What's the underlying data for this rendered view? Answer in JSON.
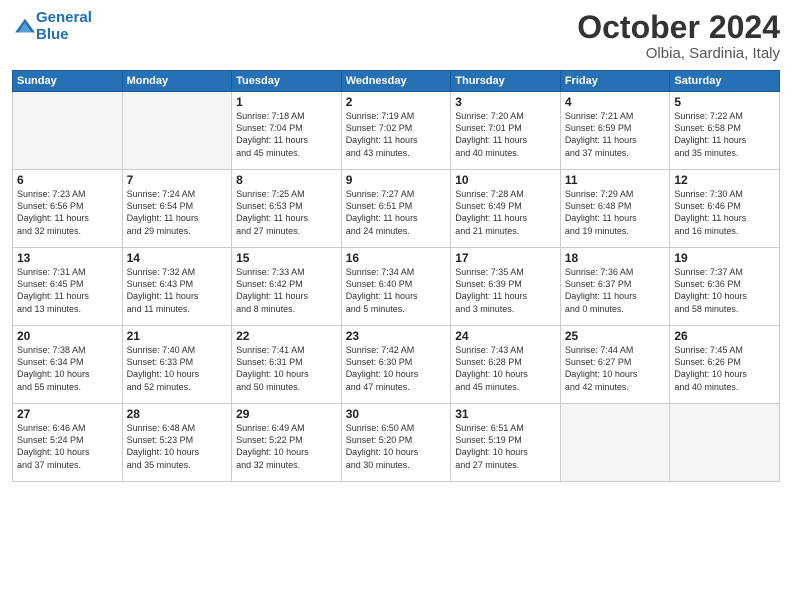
{
  "header": {
    "logo_general": "General",
    "logo_blue": "Blue",
    "month": "October 2024",
    "location": "Olbia, Sardinia, Italy"
  },
  "weekdays": [
    "Sunday",
    "Monday",
    "Tuesday",
    "Wednesday",
    "Thursday",
    "Friday",
    "Saturday"
  ],
  "weeks": [
    [
      {
        "day": "",
        "info": ""
      },
      {
        "day": "",
        "info": ""
      },
      {
        "day": "1",
        "info": "Sunrise: 7:18 AM\nSunset: 7:04 PM\nDaylight: 11 hours\nand 45 minutes."
      },
      {
        "day": "2",
        "info": "Sunrise: 7:19 AM\nSunset: 7:02 PM\nDaylight: 11 hours\nand 43 minutes."
      },
      {
        "day": "3",
        "info": "Sunrise: 7:20 AM\nSunset: 7:01 PM\nDaylight: 11 hours\nand 40 minutes."
      },
      {
        "day": "4",
        "info": "Sunrise: 7:21 AM\nSunset: 6:59 PM\nDaylight: 11 hours\nand 37 minutes."
      },
      {
        "day": "5",
        "info": "Sunrise: 7:22 AM\nSunset: 6:58 PM\nDaylight: 11 hours\nand 35 minutes."
      }
    ],
    [
      {
        "day": "6",
        "info": "Sunrise: 7:23 AM\nSunset: 6:56 PM\nDaylight: 11 hours\nand 32 minutes."
      },
      {
        "day": "7",
        "info": "Sunrise: 7:24 AM\nSunset: 6:54 PM\nDaylight: 11 hours\nand 29 minutes."
      },
      {
        "day": "8",
        "info": "Sunrise: 7:25 AM\nSunset: 6:53 PM\nDaylight: 11 hours\nand 27 minutes."
      },
      {
        "day": "9",
        "info": "Sunrise: 7:27 AM\nSunset: 6:51 PM\nDaylight: 11 hours\nand 24 minutes."
      },
      {
        "day": "10",
        "info": "Sunrise: 7:28 AM\nSunset: 6:49 PM\nDaylight: 11 hours\nand 21 minutes."
      },
      {
        "day": "11",
        "info": "Sunrise: 7:29 AM\nSunset: 6:48 PM\nDaylight: 11 hours\nand 19 minutes."
      },
      {
        "day": "12",
        "info": "Sunrise: 7:30 AM\nSunset: 6:46 PM\nDaylight: 11 hours\nand 16 minutes."
      }
    ],
    [
      {
        "day": "13",
        "info": "Sunrise: 7:31 AM\nSunset: 6:45 PM\nDaylight: 11 hours\nand 13 minutes."
      },
      {
        "day": "14",
        "info": "Sunrise: 7:32 AM\nSunset: 6:43 PM\nDaylight: 11 hours\nand 11 minutes."
      },
      {
        "day": "15",
        "info": "Sunrise: 7:33 AM\nSunset: 6:42 PM\nDaylight: 11 hours\nand 8 minutes."
      },
      {
        "day": "16",
        "info": "Sunrise: 7:34 AM\nSunset: 6:40 PM\nDaylight: 11 hours\nand 5 minutes."
      },
      {
        "day": "17",
        "info": "Sunrise: 7:35 AM\nSunset: 6:39 PM\nDaylight: 11 hours\nand 3 minutes."
      },
      {
        "day": "18",
        "info": "Sunrise: 7:36 AM\nSunset: 6:37 PM\nDaylight: 11 hours\nand 0 minutes."
      },
      {
        "day": "19",
        "info": "Sunrise: 7:37 AM\nSunset: 6:36 PM\nDaylight: 10 hours\nand 58 minutes."
      }
    ],
    [
      {
        "day": "20",
        "info": "Sunrise: 7:38 AM\nSunset: 6:34 PM\nDaylight: 10 hours\nand 55 minutes."
      },
      {
        "day": "21",
        "info": "Sunrise: 7:40 AM\nSunset: 6:33 PM\nDaylight: 10 hours\nand 52 minutes."
      },
      {
        "day": "22",
        "info": "Sunrise: 7:41 AM\nSunset: 6:31 PM\nDaylight: 10 hours\nand 50 minutes."
      },
      {
        "day": "23",
        "info": "Sunrise: 7:42 AM\nSunset: 6:30 PM\nDaylight: 10 hours\nand 47 minutes."
      },
      {
        "day": "24",
        "info": "Sunrise: 7:43 AM\nSunset: 6:28 PM\nDaylight: 10 hours\nand 45 minutes."
      },
      {
        "day": "25",
        "info": "Sunrise: 7:44 AM\nSunset: 6:27 PM\nDaylight: 10 hours\nand 42 minutes."
      },
      {
        "day": "26",
        "info": "Sunrise: 7:45 AM\nSunset: 6:26 PM\nDaylight: 10 hours\nand 40 minutes."
      }
    ],
    [
      {
        "day": "27",
        "info": "Sunrise: 6:46 AM\nSunset: 5:24 PM\nDaylight: 10 hours\nand 37 minutes."
      },
      {
        "day": "28",
        "info": "Sunrise: 6:48 AM\nSunset: 5:23 PM\nDaylight: 10 hours\nand 35 minutes."
      },
      {
        "day": "29",
        "info": "Sunrise: 6:49 AM\nSunset: 5:22 PM\nDaylight: 10 hours\nand 32 minutes."
      },
      {
        "day": "30",
        "info": "Sunrise: 6:50 AM\nSunset: 5:20 PM\nDaylight: 10 hours\nand 30 minutes."
      },
      {
        "day": "31",
        "info": "Sunrise: 6:51 AM\nSunset: 5:19 PM\nDaylight: 10 hours\nand 27 minutes."
      },
      {
        "day": "",
        "info": ""
      },
      {
        "day": "",
        "info": ""
      }
    ]
  ]
}
